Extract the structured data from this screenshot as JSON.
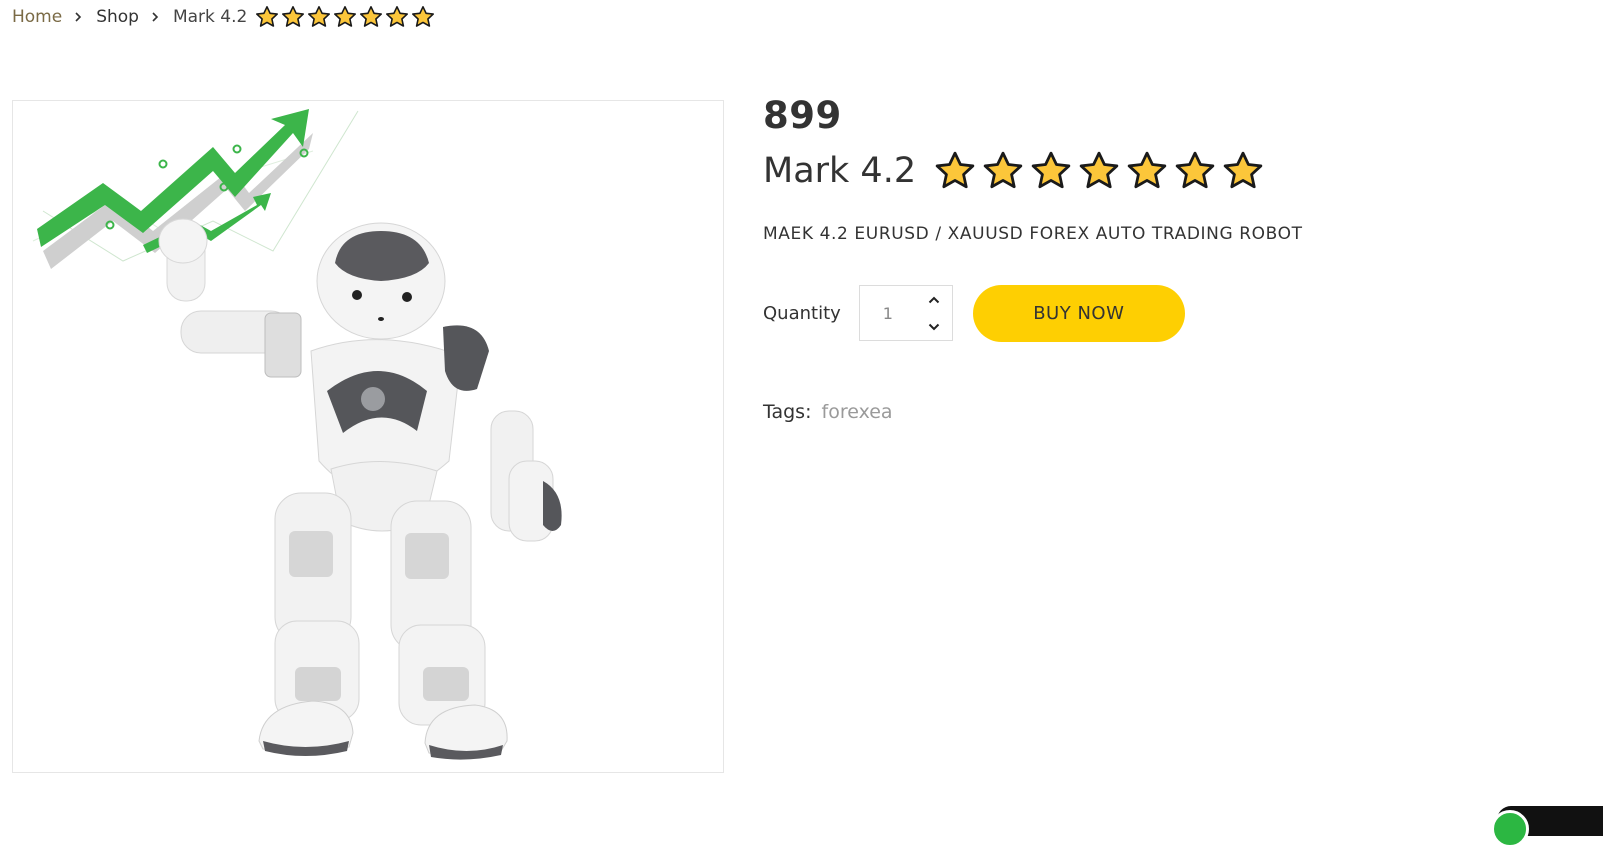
{
  "breadcrumb": {
    "home": "Home",
    "shop": "Shop",
    "current": "Mark 4.2",
    "rating_stars": 7
  },
  "product": {
    "price": "899",
    "title": "Mark 4.2",
    "rating_stars": 7,
    "short_description": "MAEK 4.2 EURUSD / XAUUSD FOREX AUTO TRADING ROBOT",
    "image_icon": "robot-with-rising-chart-image"
  },
  "cart": {
    "quantity_label": "Quantity",
    "quantity_value": "1",
    "buy_label": "BUY NOW"
  },
  "tags": {
    "label": "Tags:",
    "items": [
      "forexea"
    ]
  },
  "colors": {
    "accent": "#fecf02",
    "star_fill": "#fcc63a",
    "link": "#7a6a45",
    "chart_green": "#3cb54a",
    "whatsapp_green": "#2cb742"
  }
}
